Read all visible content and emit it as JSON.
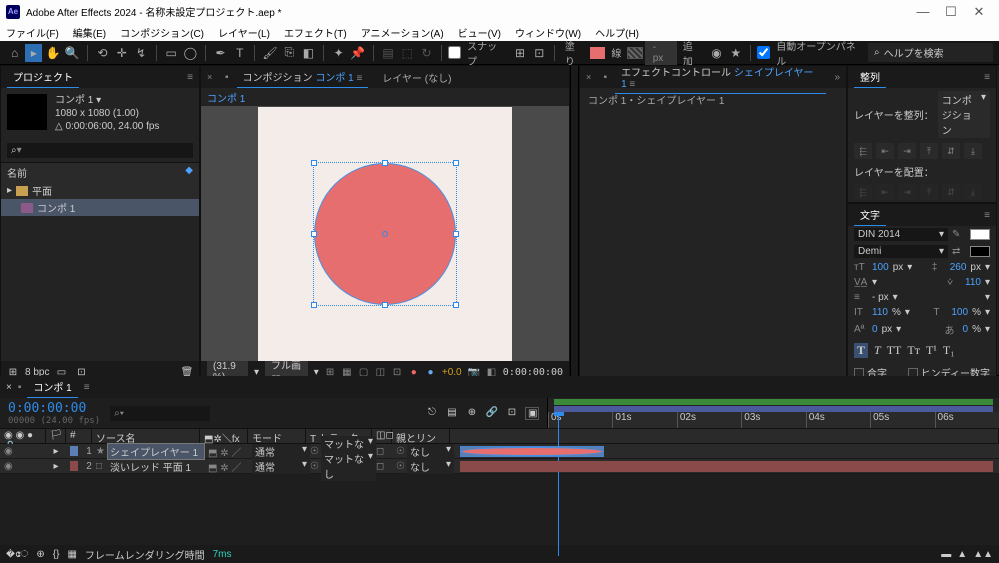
{
  "title": "Adobe After Effects 2024 - 名称未設定プロジェクト.aep *",
  "menu": [
    "ファイル(F)",
    "編集(E)",
    "コンポジション(C)",
    "レイヤー(L)",
    "エフェクト(T)",
    "アニメーション(A)",
    "ビュー(V)",
    "ウィンドウ(W)",
    "ヘルプ(H)"
  ],
  "toolbar": {
    "snap": "スナップ",
    "fill": "塗り",
    "stroke": "線",
    "px": "- px",
    "add": "追加",
    "autoopen": "自動オープンパネル",
    "search_ph": "ヘルプを検索"
  },
  "project": {
    "tab": "プロジェクト",
    "comp_name": "コンポ 1 ▾",
    "res": "1080 x 1080 (1.00)",
    "dur": "△ 0:00:06:00, 24.00 fps",
    "col_name": "名前",
    "folder": "平面",
    "comp": "コンポ 1",
    "bpc": "8 bpc"
  },
  "viewer": {
    "tab_comp": "コンポジション",
    "comp_link": "コンポ 1",
    "tab_layer": "レイヤー (なし)",
    "footer_comp": "コンポ 1",
    "zoom": "(31.9 %)",
    "res": "フル画質",
    "exp": "+0.0",
    "tc": "0:00:00:00"
  },
  "effects": {
    "tab": "エフェクトコントロール",
    "link": "シェイプレイヤー 1",
    "path": "コンポ 1・シェイプレイヤー 1"
  },
  "align": {
    "tab": "整列",
    "label": "レイヤーを整列：",
    "target": "コンポジション",
    "dist": "レイヤーを配置："
  },
  "char": {
    "tab": "文字",
    "font": "DIN 2014",
    "style": "Demi",
    "size": "100",
    "lead": "260",
    "track": "110",
    "stroke": "- px",
    "vscale": "110",
    "hscale": "100",
    "bshift": "0",
    "tsume": "0",
    "ligature": "合字",
    "hindi": "ヒンディー数字",
    "pct": "%",
    "px": "px"
  },
  "timeline": {
    "tab": "コンポ 1",
    "tc": "0:00:00:00",
    "fps": "00000 (24.00 fps)",
    "cols": {
      "src": "ソース名",
      "mode": "モード",
      "tm": "T トラックマット",
      "parent": "親とリンク"
    },
    "ticks": [
      "0s",
      "01s",
      "02s",
      "03s",
      "04s",
      "05s",
      "06s"
    ],
    "layers": [
      {
        "n": "1",
        "name": "シェイプレイヤー 1",
        "mode": "通常",
        "tm": "マットなし",
        "par": "なし",
        "color": "#5b7fb5",
        "sel": true,
        "star": "★",
        "solid": "⬒"
      },
      {
        "n": "2",
        "name": "淡いレッド 平面 1",
        "mode": "通常",
        "tm": "マットなし",
        "par": "なし",
        "color": "#8b4a4a",
        "sel": false,
        "star": "",
        "solid": "□"
      }
    ],
    "render": "フレームレンダリング時間",
    "ms": "7ms"
  }
}
